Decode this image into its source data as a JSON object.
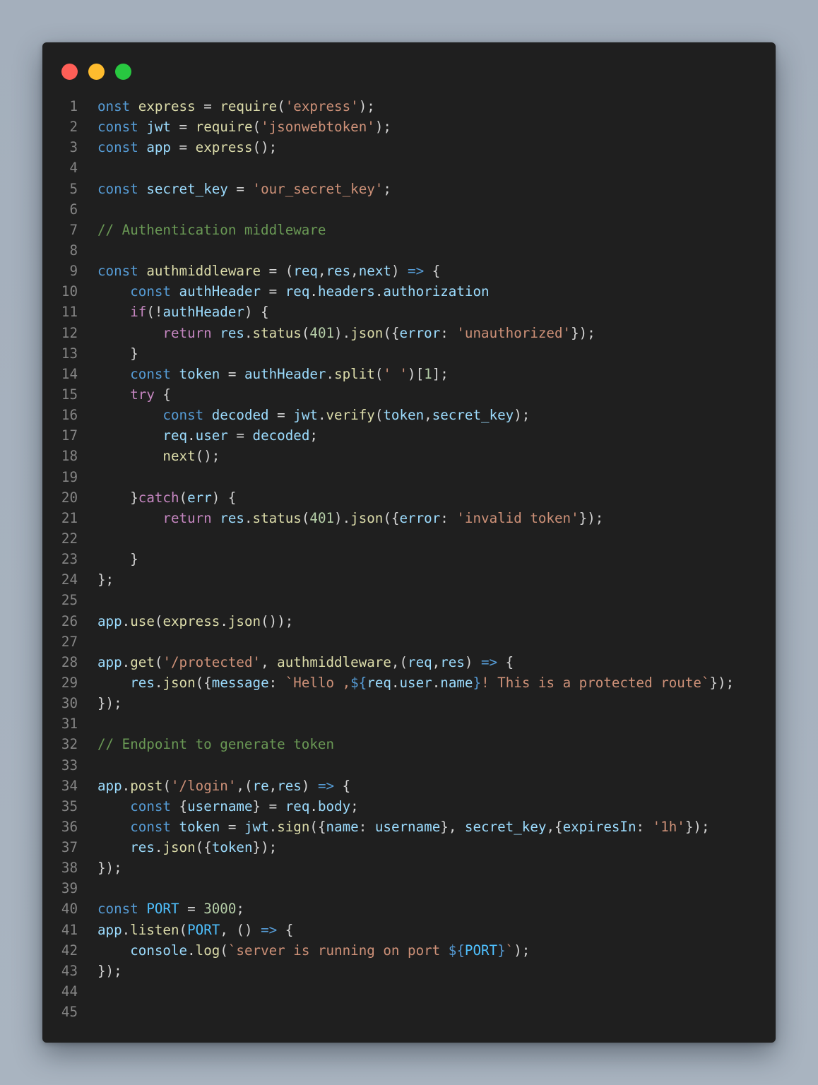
{
  "window": {
    "controls": [
      {
        "name": "close",
        "color": "#ff5f57"
      },
      {
        "name": "minimize",
        "color": "#febc2e"
      },
      {
        "name": "maximize",
        "color": "#28c840"
      }
    ]
  },
  "colors": {
    "keyword": "#569cd6",
    "control": "#c586c0",
    "function": "#dcdcaa",
    "variable": "#9cdcfe",
    "constant": "#4fc1ff",
    "string": "#ce9178",
    "number": "#b5cea8",
    "comment": "#6a9955",
    "punctuation": "#d4d4d4"
  },
  "code": {
    "lines": [
      {
        "n": "1",
        "tokens": [
          [
            "kw",
            "onst"
          ],
          [
            "p",
            " "
          ],
          [
            "fn",
            "express"
          ],
          [
            "p",
            " = "
          ],
          [
            "fn",
            "require"
          ],
          [
            "p",
            "("
          ],
          [
            "str",
            "'express'"
          ],
          [
            "p",
            ");"
          ]
        ]
      },
      {
        "n": "2",
        "tokens": [
          [
            "kw",
            "const"
          ],
          [
            "p",
            " "
          ],
          [
            "var",
            "jwt"
          ],
          [
            "p",
            " = "
          ],
          [
            "fn",
            "require"
          ],
          [
            "p",
            "("
          ],
          [
            "str",
            "'jsonwebtoken'"
          ],
          [
            "p",
            ");"
          ]
        ]
      },
      {
        "n": "3",
        "tokens": [
          [
            "kw",
            "const"
          ],
          [
            "p",
            " "
          ],
          [
            "var",
            "app"
          ],
          [
            "p",
            " = "
          ],
          [
            "fn",
            "express"
          ],
          [
            "p",
            "();"
          ]
        ]
      },
      {
        "n": "4",
        "tokens": []
      },
      {
        "n": "5",
        "tokens": [
          [
            "kw",
            "const"
          ],
          [
            "p",
            " "
          ],
          [
            "var",
            "secret_key"
          ],
          [
            "p",
            " = "
          ],
          [
            "str",
            "'our_secret_key'"
          ],
          [
            "p",
            ";"
          ]
        ]
      },
      {
        "n": "6",
        "tokens": []
      },
      {
        "n": "7",
        "tokens": [
          [
            "cmt",
            "// Authentication middleware"
          ]
        ]
      },
      {
        "n": "8",
        "tokens": []
      },
      {
        "n": "9",
        "tokens": [
          [
            "kw",
            "const"
          ],
          [
            "p",
            " "
          ],
          [
            "fn",
            "authmiddleware"
          ],
          [
            "p",
            " = ("
          ],
          [
            "var",
            "req"
          ],
          [
            "p",
            ","
          ],
          [
            "var",
            "res"
          ],
          [
            "p",
            ","
          ],
          [
            "var",
            "next"
          ],
          [
            "p",
            ") "
          ],
          [
            "kw",
            "=>"
          ],
          [
            "p",
            " {"
          ]
        ]
      },
      {
        "n": "10",
        "tokens": [
          [
            "p",
            "    "
          ],
          [
            "kw",
            "const"
          ],
          [
            "p",
            " "
          ],
          [
            "var",
            "authHeader"
          ],
          [
            "p",
            " = "
          ],
          [
            "var",
            "req"
          ],
          [
            "p",
            "."
          ],
          [
            "var",
            "headers"
          ],
          [
            "p",
            "."
          ],
          [
            "var",
            "authorization"
          ]
        ]
      },
      {
        "n": "11",
        "tokens": [
          [
            "p",
            "    "
          ],
          [
            "ctl",
            "if"
          ],
          [
            "p",
            "(!"
          ],
          [
            "var",
            "authHeader"
          ],
          [
            "p",
            ") {"
          ]
        ]
      },
      {
        "n": "12",
        "tokens": [
          [
            "p",
            "        "
          ],
          [
            "ctl",
            "return"
          ],
          [
            "p",
            " "
          ],
          [
            "var",
            "res"
          ],
          [
            "p",
            "."
          ],
          [
            "fn",
            "status"
          ],
          [
            "p",
            "("
          ],
          [
            "num",
            "401"
          ],
          [
            "p",
            ")."
          ],
          [
            "fn",
            "json"
          ],
          [
            "p",
            "({"
          ],
          [
            "var",
            "error"
          ],
          [
            "p",
            ": "
          ],
          [
            "str",
            "'unauthorized'"
          ],
          [
            "p",
            "});"
          ]
        ]
      },
      {
        "n": "13",
        "tokens": [
          [
            "p",
            "    }"
          ]
        ]
      },
      {
        "n": "14",
        "tokens": [
          [
            "p",
            "    "
          ],
          [
            "kw",
            "const"
          ],
          [
            "p",
            " "
          ],
          [
            "var",
            "token"
          ],
          [
            "p",
            " = "
          ],
          [
            "var",
            "authHeader"
          ],
          [
            "p",
            "."
          ],
          [
            "fn",
            "split"
          ],
          [
            "p",
            "("
          ],
          [
            "str",
            "' '"
          ],
          [
            "p",
            ")["
          ],
          [
            "num",
            "1"
          ],
          [
            "p",
            "];"
          ]
        ]
      },
      {
        "n": "15",
        "tokens": [
          [
            "p",
            "    "
          ],
          [
            "ctl",
            "try"
          ],
          [
            "p",
            " {"
          ]
        ]
      },
      {
        "n": "16",
        "tokens": [
          [
            "p",
            "        "
          ],
          [
            "kw",
            "const"
          ],
          [
            "p",
            " "
          ],
          [
            "var",
            "decoded"
          ],
          [
            "p",
            " = "
          ],
          [
            "var",
            "jwt"
          ],
          [
            "p",
            "."
          ],
          [
            "fn",
            "verify"
          ],
          [
            "p",
            "("
          ],
          [
            "var",
            "token"
          ],
          [
            "p",
            ","
          ],
          [
            "var",
            "secret_key"
          ],
          [
            "p",
            ");"
          ]
        ]
      },
      {
        "n": "17",
        "tokens": [
          [
            "p",
            "        "
          ],
          [
            "var",
            "req"
          ],
          [
            "p",
            "."
          ],
          [
            "var",
            "user"
          ],
          [
            "p",
            " = "
          ],
          [
            "var",
            "decoded"
          ],
          [
            "p",
            ";"
          ]
        ]
      },
      {
        "n": "18",
        "tokens": [
          [
            "p",
            "        "
          ],
          [
            "fn",
            "next"
          ],
          [
            "p",
            "();"
          ]
        ]
      },
      {
        "n": "19",
        "tokens": []
      },
      {
        "n": "20",
        "tokens": [
          [
            "p",
            "    }"
          ],
          [
            "ctl",
            "catch"
          ],
          [
            "p",
            "("
          ],
          [
            "var",
            "err"
          ],
          [
            "p",
            ") {"
          ]
        ]
      },
      {
        "n": "21",
        "tokens": [
          [
            "p",
            "        "
          ],
          [
            "ctl",
            "return"
          ],
          [
            "p",
            " "
          ],
          [
            "var",
            "res"
          ],
          [
            "p",
            "."
          ],
          [
            "fn",
            "status"
          ],
          [
            "p",
            "("
          ],
          [
            "num",
            "401"
          ],
          [
            "p",
            ")."
          ],
          [
            "fn",
            "json"
          ],
          [
            "p",
            "({"
          ],
          [
            "var",
            "error"
          ],
          [
            "p",
            ": "
          ],
          [
            "str",
            "'invalid token'"
          ],
          [
            "p",
            "});"
          ]
        ]
      },
      {
        "n": "22",
        "tokens": []
      },
      {
        "n": "23",
        "tokens": [
          [
            "p",
            "    }"
          ]
        ]
      },
      {
        "n": "24",
        "tokens": [
          [
            "p",
            "};"
          ]
        ]
      },
      {
        "n": "25",
        "tokens": []
      },
      {
        "n": "26",
        "tokens": [
          [
            "var",
            "app"
          ],
          [
            "p",
            "."
          ],
          [
            "fn",
            "use"
          ],
          [
            "p",
            "("
          ],
          [
            "fn",
            "express"
          ],
          [
            "p",
            "."
          ],
          [
            "fn",
            "json"
          ],
          [
            "p",
            "());"
          ]
        ]
      },
      {
        "n": "27",
        "tokens": []
      },
      {
        "n": "28",
        "tokens": [
          [
            "var",
            "app"
          ],
          [
            "p",
            "."
          ],
          [
            "fn",
            "get"
          ],
          [
            "p",
            "("
          ],
          [
            "str",
            "'/protected'"
          ],
          [
            "p",
            ", "
          ],
          [
            "fn",
            "authmiddleware"
          ],
          [
            "p",
            ",("
          ],
          [
            "var",
            "req"
          ],
          [
            "p",
            ","
          ],
          [
            "var",
            "res"
          ],
          [
            "p",
            ") "
          ],
          [
            "kw",
            "=>"
          ],
          [
            "p",
            " {"
          ]
        ]
      },
      {
        "n": "29",
        "tokens": [
          [
            "p",
            "    "
          ],
          [
            "var",
            "res"
          ],
          [
            "p",
            "."
          ],
          [
            "fn",
            "json"
          ],
          [
            "p",
            "({"
          ],
          [
            "var",
            "message"
          ],
          [
            "p",
            ": "
          ],
          [
            "str",
            "`Hello ,"
          ],
          [
            "kw",
            "${"
          ],
          [
            "var",
            "req"
          ],
          [
            "p",
            "."
          ],
          [
            "var",
            "user"
          ],
          [
            "p",
            "."
          ],
          [
            "var",
            "name"
          ],
          [
            "kw",
            "}"
          ],
          [
            "str",
            "! This is a protected route`"
          ],
          [
            "p",
            "});"
          ]
        ]
      },
      {
        "n": "30",
        "tokens": [
          [
            "p",
            "});"
          ]
        ]
      },
      {
        "n": "31",
        "tokens": []
      },
      {
        "n": "32",
        "tokens": [
          [
            "cmt",
            "// Endpoint to generate token"
          ]
        ]
      },
      {
        "n": "33",
        "tokens": []
      },
      {
        "n": "34",
        "tokens": [
          [
            "var",
            "app"
          ],
          [
            "p",
            "."
          ],
          [
            "fn",
            "post"
          ],
          [
            "p",
            "("
          ],
          [
            "str",
            "'/login'"
          ],
          [
            "p",
            ",("
          ],
          [
            "var",
            "re"
          ],
          [
            "p",
            ","
          ],
          [
            "var",
            "res"
          ],
          [
            "p",
            ") "
          ],
          [
            "kw",
            "=>"
          ],
          [
            "p",
            " {"
          ]
        ]
      },
      {
        "n": "35",
        "tokens": [
          [
            "p",
            "    "
          ],
          [
            "kw",
            "const"
          ],
          [
            "p",
            " {"
          ],
          [
            "var",
            "username"
          ],
          [
            "p",
            "} = "
          ],
          [
            "var",
            "req"
          ],
          [
            "p",
            "."
          ],
          [
            "var",
            "body"
          ],
          [
            "p",
            ";"
          ]
        ]
      },
      {
        "n": "36",
        "tokens": [
          [
            "p",
            "    "
          ],
          [
            "kw",
            "const"
          ],
          [
            "p",
            " "
          ],
          [
            "var",
            "token"
          ],
          [
            "p",
            " = "
          ],
          [
            "var",
            "jwt"
          ],
          [
            "p",
            "."
          ],
          [
            "fn",
            "sign"
          ],
          [
            "p",
            "({"
          ],
          [
            "var",
            "name"
          ],
          [
            "p",
            ": "
          ],
          [
            "var",
            "username"
          ],
          [
            "p",
            "}, "
          ],
          [
            "var",
            "secret_key"
          ],
          [
            "p",
            ",{"
          ],
          [
            "var",
            "expiresIn"
          ],
          [
            "p",
            ": "
          ],
          [
            "str",
            "'1h'"
          ],
          [
            "p",
            "});"
          ]
        ]
      },
      {
        "n": "37",
        "tokens": [
          [
            "p",
            "    "
          ],
          [
            "var",
            "res"
          ],
          [
            "p",
            "."
          ],
          [
            "fn",
            "json"
          ],
          [
            "p",
            "({"
          ],
          [
            "var",
            "token"
          ],
          [
            "p",
            "});"
          ]
        ]
      },
      {
        "n": "38",
        "tokens": [
          [
            "p",
            "});"
          ]
        ]
      },
      {
        "n": "39",
        "tokens": []
      },
      {
        "n": "40",
        "tokens": [
          [
            "kw",
            "const"
          ],
          [
            "p",
            " "
          ],
          [
            "const",
            "PORT"
          ],
          [
            "p",
            " = "
          ],
          [
            "num",
            "3000"
          ],
          [
            "p",
            ";"
          ]
        ]
      },
      {
        "n": "41",
        "tokens": [
          [
            "var",
            "app"
          ],
          [
            "p",
            "."
          ],
          [
            "fn",
            "listen"
          ],
          [
            "p",
            "("
          ],
          [
            "const",
            "PORT"
          ],
          [
            "p",
            ", () "
          ],
          [
            "kw",
            "=>"
          ],
          [
            "p",
            " {"
          ]
        ]
      },
      {
        "n": "42",
        "tokens": [
          [
            "p",
            "    "
          ],
          [
            "var",
            "console"
          ],
          [
            "p",
            "."
          ],
          [
            "fn",
            "log"
          ],
          [
            "p",
            "("
          ],
          [
            "str",
            "`server is running on port "
          ],
          [
            "kw",
            "${"
          ],
          [
            "const",
            "PORT"
          ],
          [
            "kw",
            "}"
          ],
          [
            "str",
            "`"
          ],
          [
            "p",
            ");"
          ]
        ]
      },
      {
        "n": "43",
        "tokens": [
          [
            "p",
            "});"
          ]
        ]
      },
      {
        "n": "44",
        "tokens": []
      },
      {
        "n": "45",
        "tokens": []
      }
    ]
  }
}
